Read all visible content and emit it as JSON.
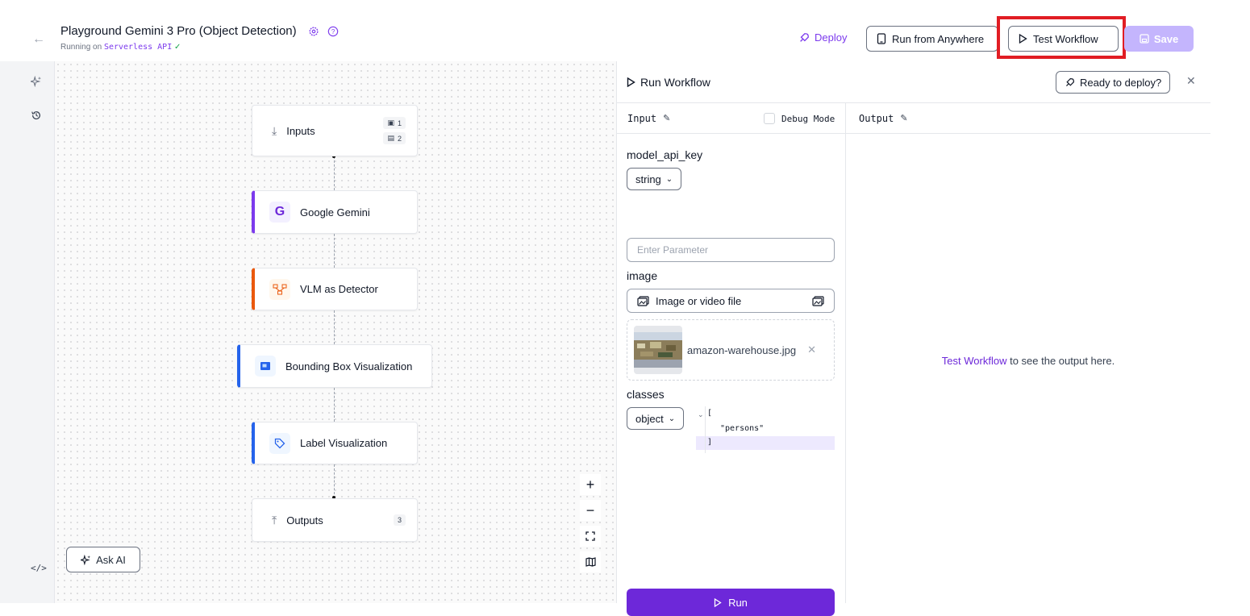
{
  "header": {
    "title": "Playground Gemini 3 Pro (Object Detection)",
    "running_prefix": "Running on",
    "running_target": "Serverless API",
    "deploy_label": "Deploy",
    "run_anywhere_label": "Run from Anywhere",
    "test_workflow_label": "Test Workflow",
    "save_label": "Save"
  },
  "canvas": {
    "nodes": [
      {
        "label": "Inputs",
        "badge_image": "1",
        "badge_text": "2"
      },
      {
        "label": "Google Gemini"
      },
      {
        "label": "VLM as Detector"
      },
      {
        "label": "Bounding Box Visualization"
      },
      {
        "label": "Label Visualization"
      },
      {
        "label": "Outputs",
        "badge": "3"
      }
    ],
    "zoom_in": "+",
    "zoom_out": "−",
    "ask_ai_label": "Ask AI"
  },
  "panel": {
    "title": "Run Workflow",
    "ready_label": "Ready to deploy?",
    "input_heading": "Input",
    "debug_label": "Debug Mode",
    "output_heading": "Output",
    "fields": {
      "api_key_label": "model_api_key",
      "api_key_type": "string",
      "api_key_placeholder": "Enter Parameter",
      "image_label": "image",
      "image_button": "Image or video file",
      "image_file": "amazon-warehouse.jpg",
      "classes_label": "classes",
      "classes_type": "object",
      "code_open": "[",
      "code_value": "\"persons\"",
      "code_close": "]"
    },
    "run_label": "Run",
    "output_link": "Test Workflow",
    "output_suffix": " to see the output here."
  },
  "colors": {
    "accent": "#6d28d9",
    "highlight": "#e11d24",
    "save_disabled": "#c4b5fd"
  }
}
